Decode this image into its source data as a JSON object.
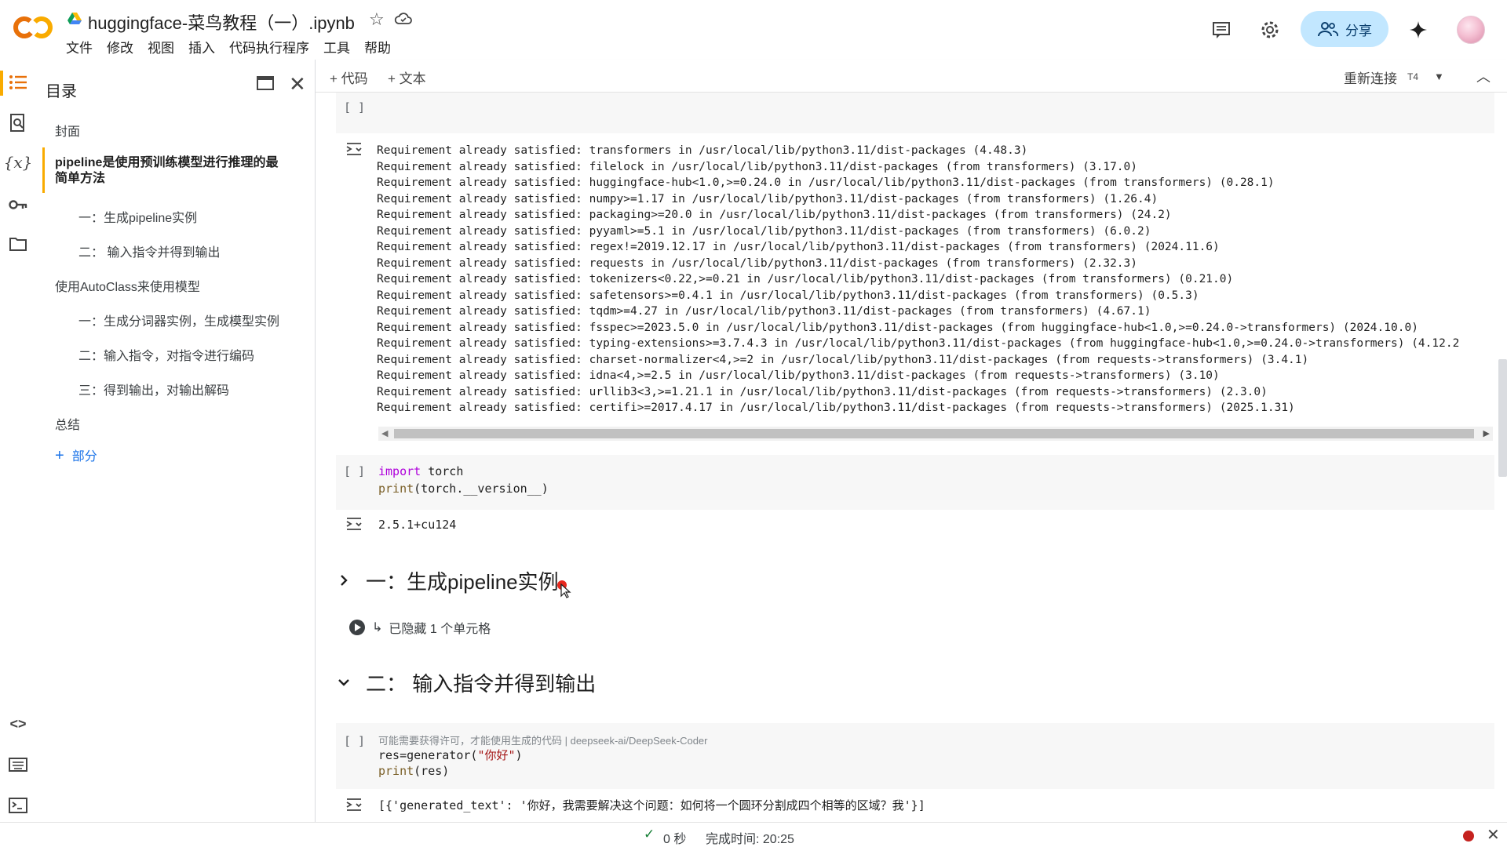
{
  "header": {
    "logo_text": "CO",
    "doc_title": "huggingface-菜鸟教程（一）.ipynb",
    "menu": [
      "文件",
      "修改",
      "视图",
      "插入",
      "代码执行程序",
      "工具",
      "帮助"
    ],
    "share_label": "分享",
    "brand_color": "#f9ab00"
  },
  "toolbar": {
    "add_code": "+ 代码",
    "add_text": "+ 文本",
    "reconnect": "重新连接",
    "runtime_type": "T4"
  },
  "rail": {
    "icons": [
      "toc-icon",
      "find-icon",
      "variables-icon",
      "secrets-icon",
      "files-icon"
    ],
    "bottom_icons": [
      "code-snippets-icon",
      "command-palette-icon",
      "terminal-icon"
    ]
  },
  "toc": {
    "title": "目录",
    "items": [
      {
        "label": "封面",
        "level": 1
      },
      {
        "label": "pipeline是使用预训练模型进行推理的最简单方法",
        "level": 1,
        "active": true
      },
      {
        "label": "一：生成pipeline实例",
        "level": 2
      },
      {
        "label": "二： 输入指令并得到输出",
        "level": 2
      },
      {
        "label": "使用AutoClass来使用模型",
        "level": 1
      },
      {
        "label": "一：生成分词器实例，生成模型实例",
        "level": 2
      },
      {
        "label": "二：输入指令，对指令进行编码",
        "level": 2
      },
      {
        "label": "三：得到输出，对输出解码",
        "level": 2
      },
      {
        "label": "总结",
        "level": 1
      }
    ],
    "add_section": "部分"
  },
  "cells": {
    "cell1_bracket": "[ ]",
    "pip_output": [
      "Requirement already satisfied: transformers in /usr/local/lib/python3.11/dist-packages (4.48.3)",
      "Requirement already satisfied: filelock in /usr/local/lib/python3.11/dist-packages (from transformers) (3.17.0)",
      "Requirement already satisfied: huggingface-hub<1.0,>=0.24.0 in /usr/local/lib/python3.11/dist-packages (from transformers) (0.28.1)",
      "Requirement already satisfied: numpy>=1.17 in /usr/local/lib/python3.11/dist-packages (from transformers) (1.26.4)",
      "Requirement already satisfied: packaging>=20.0 in /usr/local/lib/python3.11/dist-packages (from transformers) (24.2)",
      "Requirement already satisfied: pyyaml>=5.1 in /usr/local/lib/python3.11/dist-packages (from transformers) (6.0.2)",
      "Requirement already satisfied: regex!=2019.12.17 in /usr/local/lib/python3.11/dist-packages (from transformers) (2024.11.6)",
      "Requirement already satisfied: requests in /usr/local/lib/python3.11/dist-packages (from transformers) (2.32.3)",
      "Requirement already satisfied: tokenizers<0.22,>=0.21 in /usr/local/lib/python3.11/dist-packages (from transformers) (0.21.0)",
      "Requirement already satisfied: safetensors>=0.4.1 in /usr/local/lib/python3.11/dist-packages (from transformers) (0.5.3)",
      "Requirement already satisfied: tqdm>=4.27 in /usr/local/lib/python3.11/dist-packages (from transformers) (4.67.1)",
      "Requirement already satisfied: fsspec>=2023.5.0 in /usr/local/lib/python3.11/dist-packages (from huggingface-hub<1.0,>=0.24.0->transformers) (2024.10.0)",
      "Requirement already satisfied: typing-extensions>=3.7.4.3 in /usr/local/lib/python3.11/dist-packages (from huggingface-hub<1.0,>=0.24.0->transformers) (4.12.2",
      "Requirement already satisfied: charset-normalizer<4,>=2 in /usr/local/lib/python3.11/dist-packages (from requests->transformers) (3.4.1)",
      "Requirement already satisfied: idna<4,>=2.5 in /usr/local/lib/python3.11/dist-packages (from requests->transformers) (3.10)",
      "Requirement already satisfied: urllib3<3,>=1.21.1 in /usr/local/lib/python3.11/dist-packages (from requests->transformers) (2.3.0)",
      "Requirement already satisfied: certifi>=2017.4.17 in /usr/local/lib/python3.11/dist-packages (from requests->transformers) (2025.1.31)"
    ],
    "cell2_bracket": "[ ]",
    "cell2_code": {
      "kw_import": "import",
      "module": " torch",
      "fn_print": "print",
      "args": "(torch.__version__)"
    },
    "cell2_output": "2.5.1+cu124",
    "heading1": "一：生成pipeline实例",
    "hidden_cells": "已隐藏 1 个单元格",
    "heading2": "二： 输入指令并得到输出",
    "cell3_bracket": "[ ]",
    "cell3_notice": "可能需要获得许可，才能使用生成的代码 | deepseek-ai/DeepSeek-Coder",
    "cell3_line1_pre": "res=generator(",
    "cell3_line1_str": "\"你好\"",
    "cell3_line1_post": ")",
    "cell3_line2_fn": "print",
    "cell3_line2_args": "(res)",
    "cell3_output": "[{'generated_text': '你好，我需要解决这个问题：如何将一个圆环分割成四个相等的区域？我'}]"
  },
  "status": {
    "seconds": "0 秒",
    "done": "完成时间: 20:25"
  }
}
